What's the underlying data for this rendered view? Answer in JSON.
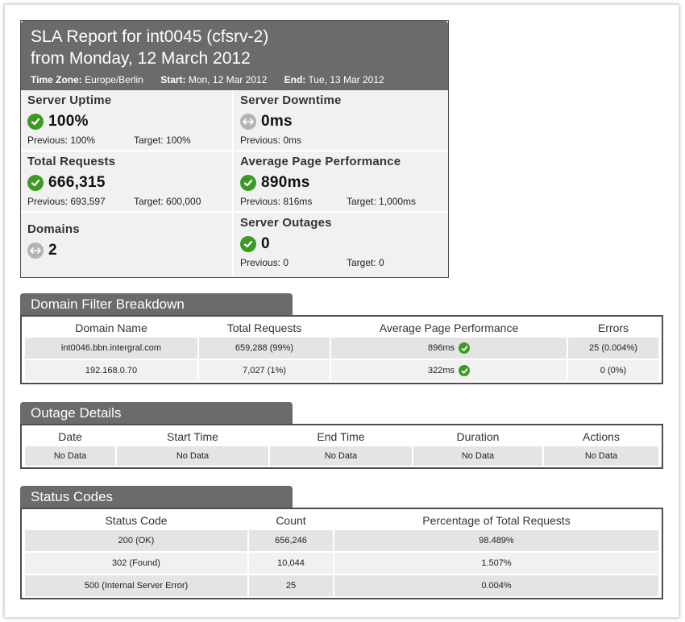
{
  "report": {
    "title_line1": "SLA Report for int0045 (cfsrv-2)",
    "title_line2": "from Monday, 12 March 2012",
    "timezone_label": "Time Zone:",
    "timezone_value": "Europe/Berlin",
    "start_label": "Start:",
    "start_value": "Mon, 12 Mar 2012",
    "end_label": "End:",
    "end_value": "Tue, 13 Mar 2012"
  },
  "metrics": {
    "uptime": {
      "title": "Server Uptime",
      "value": "100%",
      "previous": "Previous: 100%",
      "target": "Target: 100%",
      "status": "ok"
    },
    "downtime": {
      "title": "Server Downtime",
      "value": "0ms",
      "previous": "Previous: 0ms",
      "status": "neutral"
    },
    "requests": {
      "title": "Total Requests",
      "value": "666,315",
      "previous": "Previous: 693,597",
      "target": "Target: 600,000",
      "status": "ok"
    },
    "performance": {
      "title": "Average Page Performance",
      "value": "890ms",
      "previous": "Previous: 816ms",
      "target": "Target: 1,000ms",
      "status": "ok"
    },
    "domains": {
      "title": "Domains",
      "value": "2",
      "status": "neutral"
    },
    "outages": {
      "title": "Server Outages",
      "value": "0",
      "previous": "Previous: 0",
      "target": "Target: 0",
      "status": "ok"
    }
  },
  "domain_filter": {
    "title": "Domain Filter Breakdown",
    "headers": [
      "Domain Name",
      "Total Requests",
      "Average Page Performance",
      "Errors"
    ],
    "rows": [
      {
        "domain": "int0046.bbn.intergral.com",
        "requests": "659,288 (99%)",
        "performance": "896ms",
        "errors": "25 (0.004%)"
      },
      {
        "domain": "192.168.0.70",
        "requests": "7,027 (1%)",
        "performance": "322ms",
        "errors": "0 (0%)"
      }
    ]
  },
  "outage_details": {
    "title": "Outage Details",
    "headers": [
      "Date",
      "Start Time",
      "End Time",
      "Duration",
      "Actions"
    ],
    "row": [
      "No Data",
      "No Data",
      "No Data",
      "No Data",
      "No Data"
    ]
  },
  "status_codes": {
    "title": "Status Codes",
    "headers": [
      "Status Code",
      "Count",
      "Percentage of Total Requests"
    ],
    "rows": [
      {
        "code": "200 (OK)",
        "count": "656,246",
        "percent": "98.489%"
      },
      {
        "code": "302 (Found)",
        "count": "10,044",
        "percent": "1.507%"
      },
      {
        "code": "500 (Internal Server Error)",
        "count": "25",
        "percent": "0.004%"
      }
    ]
  },
  "colors": {
    "header_bg": "#6b6b6b",
    "ok_green": "#3c9a24",
    "neutral_grey": "#b3b3b3"
  }
}
